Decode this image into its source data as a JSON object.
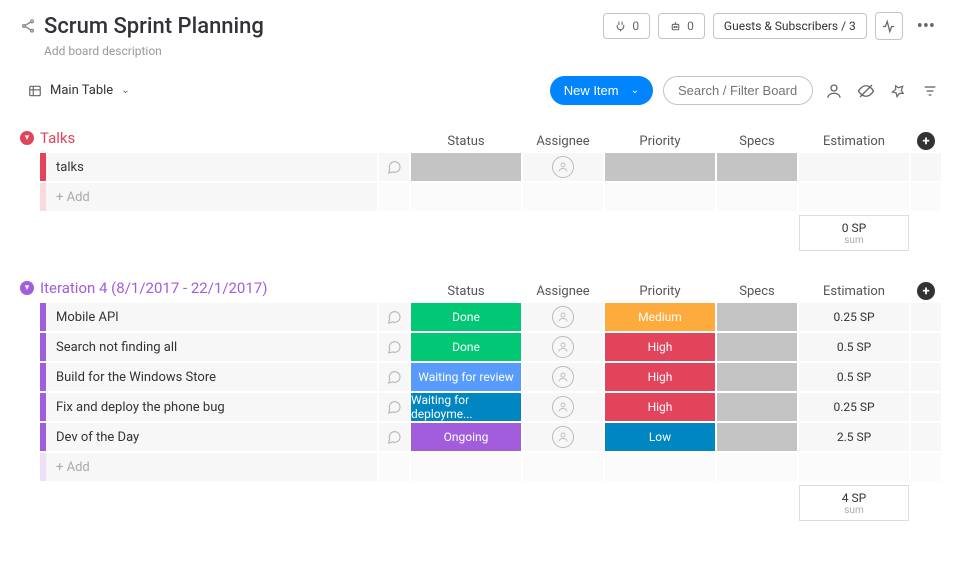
{
  "header": {
    "title": "Scrum Sprint Planning",
    "subtitle": "Add board description",
    "guests_label": "Guests & Subscribers / 3",
    "plug_count": "0",
    "robot_count": "0"
  },
  "toolbar": {
    "view_label": "Main Table",
    "new_item_label": "New Item",
    "search_placeholder": "Search / Filter Board"
  },
  "columns": [
    "Status",
    "Assignee",
    "Priority",
    "Specs",
    "Estimation"
  ],
  "groups": [
    {
      "title": "Talks",
      "color": "#e2445c",
      "stripe": "#e2445c",
      "tint": "#f7b3be",
      "items": [
        {
          "name": "talks",
          "status": {
            "text": "",
            "bg": "#c4c4c4"
          },
          "priority": {
            "text": "",
            "bg": "#c4c4c4"
          },
          "specs": {
            "text": "",
            "bg": "#c4c4c4"
          },
          "estimation": ""
        }
      ],
      "add_label": "+ Add",
      "sum": "0 SP",
      "sum_label": "sum"
    },
    {
      "title": "Iteration 4 (8/1/2017 - 22/1/2017)",
      "color": "#a25ddc",
      "stripe": "#a25ddc",
      "tint": "#d9c0ef",
      "items": [
        {
          "name": "Mobile API",
          "status": {
            "text": "Done",
            "bg": "#00c875"
          },
          "priority": {
            "text": "Medium",
            "bg": "#fdab3d"
          },
          "specs": {
            "text": "",
            "bg": "#c4c4c4"
          },
          "estimation": "0.25 SP"
        },
        {
          "name": "Search not finding all",
          "status": {
            "text": "Done",
            "bg": "#00c875"
          },
          "priority": {
            "text": "High",
            "bg": "#e2445c"
          },
          "specs": {
            "text": "",
            "bg": "#c4c4c4"
          },
          "estimation": "0.5 SP"
        },
        {
          "name": "Build for the Windows Store",
          "status": {
            "text": "Waiting for review",
            "bg": "#579bfc"
          },
          "priority": {
            "text": "High",
            "bg": "#e2445c"
          },
          "specs": {
            "text": "",
            "bg": "#c4c4c4"
          },
          "estimation": "0.5 SP"
        },
        {
          "name": "Fix and deploy the phone bug",
          "status": {
            "text": "Waiting for deployme...",
            "bg": "#0086c0"
          },
          "priority": {
            "text": "High",
            "bg": "#e2445c"
          },
          "specs": {
            "text": "",
            "bg": "#c4c4c4"
          },
          "estimation": "0.25 SP"
        },
        {
          "name": "Dev of the Day",
          "status": {
            "text": "Ongoing",
            "bg": "#a25ddc"
          },
          "priority": {
            "text": "Low",
            "bg": "#0086c0"
          },
          "specs": {
            "text": "",
            "bg": "#c4c4c4"
          },
          "estimation": "2.5 SP"
        }
      ],
      "add_label": "+ Add",
      "sum": "4 SP",
      "sum_label": "sum"
    }
  ]
}
